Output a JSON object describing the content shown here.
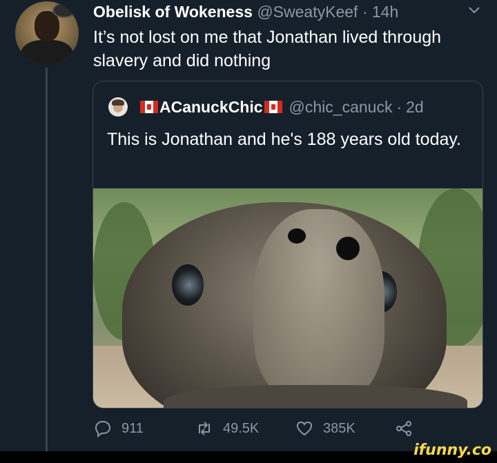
{
  "tweet": {
    "author_name": "Obelisk of Wokeness",
    "author_handle": "@SweatyKeef",
    "separator": "·",
    "time": "14h",
    "text": "It’s not lost on me that Jonathan lived through slavery and did nothing"
  },
  "quoted_tweet": {
    "author_name": "ACanuckChic",
    "author_handle": "@chic_canuck",
    "separator": "·",
    "time": "2d",
    "text": "This is Jonathan and he's 188 years old today.",
    "image": "tortoise-face-closeup"
  },
  "actions": {
    "replies": "911",
    "retweets": "49.5K",
    "likes": "385K"
  },
  "icons": {
    "reply": "speech-bubble-icon",
    "retweet": "retweet-arrows-icon",
    "like": "heart-icon",
    "share": "share-icon",
    "more": "chevron-down-icon"
  },
  "watermark": "ifunny.co",
  "colors": {
    "background": "#15202b",
    "secondary_text": "#8899a6",
    "border": "#38444d",
    "watermark": "#f7d84a"
  }
}
